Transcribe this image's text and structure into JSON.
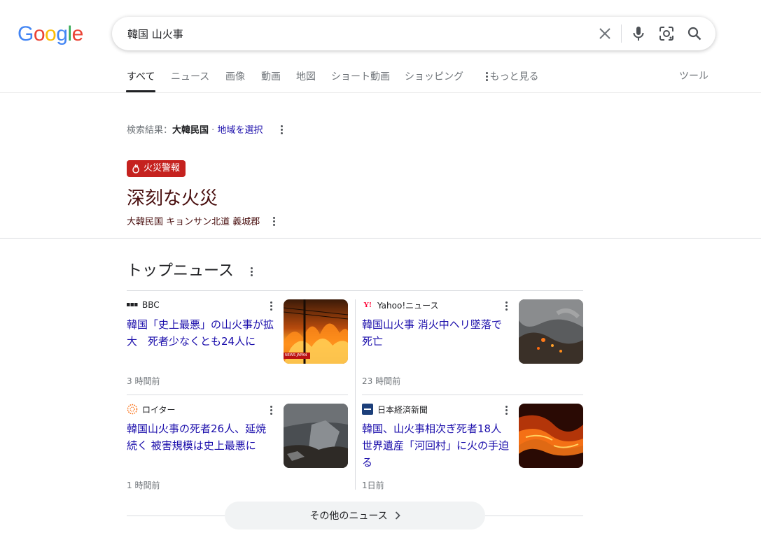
{
  "logo": {
    "letters": [
      "G",
      "o",
      "o",
      "g",
      "l",
      "e"
    ],
    "colors": [
      "#4285f4",
      "#ea4335",
      "#fbbc05",
      "#4285f4",
      "#34a853",
      "#ea4335"
    ]
  },
  "search": {
    "query": "韓国 山火事",
    "icons": [
      "close-icon",
      "mic-icon",
      "lens-icon",
      "search-icon"
    ]
  },
  "tabs": [
    {
      "label": "すべて",
      "active": true
    },
    {
      "label": "ニュース"
    },
    {
      "label": "画像"
    },
    {
      "label": "動画"
    },
    {
      "label": "地図"
    },
    {
      "label": "ショート動画"
    },
    {
      "label": "ショッピング"
    },
    {
      "label": "もっと見る"
    }
  ],
  "tools_label": "ツール",
  "region": {
    "prefix": "検索結果：",
    "country": "大韓民国",
    "separator": "·",
    "change_link": "地域を選択"
  },
  "alert": {
    "badge": "火災警報",
    "title": "深刻な火災",
    "location": "大韓民国 キョンサン北道 義城郡",
    "color": "#c5221f"
  },
  "top_news": {
    "heading": "トップニュース",
    "articles": [
      {
        "source": "BBC",
        "source_icon": "bbc-logo",
        "headline": "韓国「史上最悪」の山火事が拡大　死者少なくとも24人に",
        "time": "3 時間前",
        "thumb_label": "NEWS JAPAN",
        "thumb_icon": "wildfire-night-photo"
      },
      {
        "source": "Yahoo!ニュース",
        "source_icon": "yahoo-logo",
        "headline": "韓国山火事 消火中ヘリ墜落で死亡",
        "time": "23 時間前",
        "thumb_icon": "smoke-aerial-photo"
      },
      {
        "source": "ロイター",
        "source_icon": "reuters-logo",
        "headline": "韓国山火事の死者26人、延焼続く 被害規模は史上最悪に",
        "time": "1 時間前",
        "thumb_icon": "burned-temple-photo"
      },
      {
        "source": "日本経済新聞",
        "source_icon": "nikkei-logo",
        "headline": "韓国、山火事相次ぎ死者18人 世界遺産「河回村」に火の手迫る",
        "time": "1日前",
        "thumb_icon": "fire-aerial-photo"
      }
    ],
    "more_label": "その他のニュース"
  }
}
